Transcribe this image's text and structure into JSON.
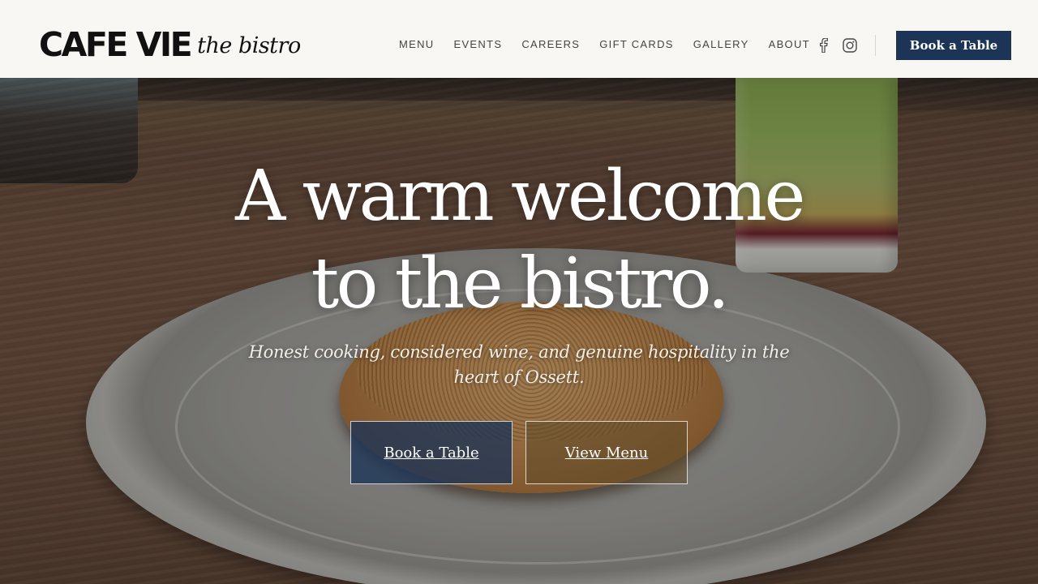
{
  "brand": {
    "name": "CAFE VIE",
    "tagline": "the bistro"
  },
  "nav": {
    "items": [
      "MENU",
      "EVENTS",
      "CAREERS",
      "GIFT CARDS",
      "GALLERY",
      "ABOUT"
    ]
  },
  "social": {
    "icons": [
      "facebook-icon",
      "instagram-icon"
    ]
  },
  "header": {
    "cta_label": "Book a Table"
  },
  "hero": {
    "title_line1": "A warm welcome",
    "title_line2": "to the bistro.",
    "subtitle": "Honest cooking, considered wine, and genuine hospitality in the heart of Ossett.",
    "primary_label": "Book a Table",
    "secondary_label": "View Menu"
  },
  "colors": {
    "accent": "#1c3557",
    "header_bg": "#f8f7f4",
    "nav_text": "#444444"
  }
}
